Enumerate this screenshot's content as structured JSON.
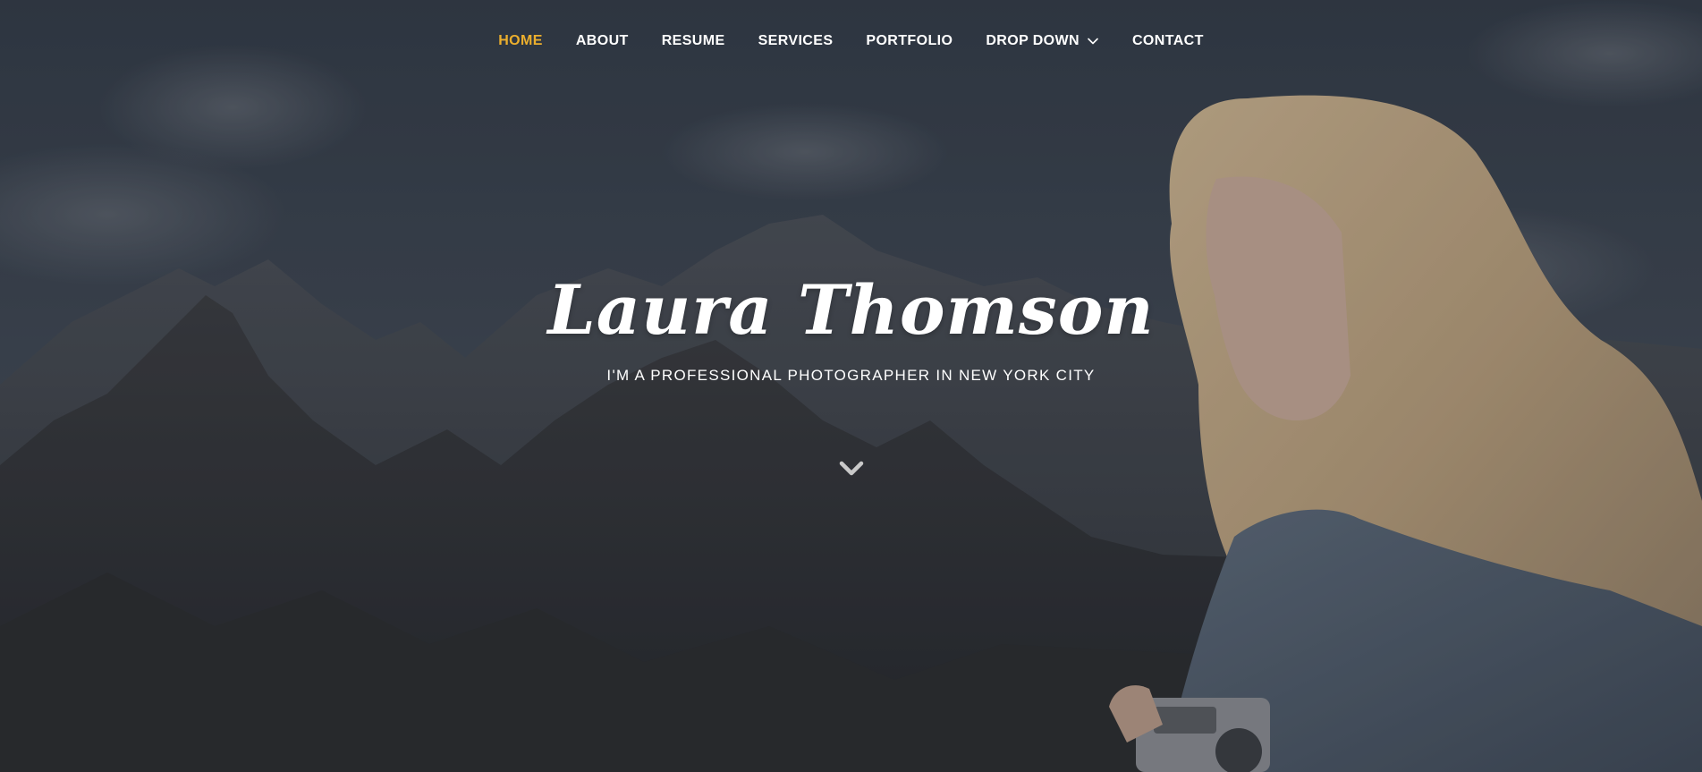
{
  "nav": {
    "items": [
      {
        "label": "HOME",
        "active": true
      },
      {
        "label": "ABOUT",
        "active": false
      },
      {
        "label": "RESUME",
        "active": false
      },
      {
        "label": "SERVICES",
        "active": false
      },
      {
        "label": "PORTFOLIO",
        "active": false
      },
      {
        "label": "DROP DOWN",
        "active": false,
        "has_dropdown": true
      },
      {
        "label": "CONTACT",
        "active": false
      }
    ]
  },
  "hero": {
    "name": "Laura Thomson",
    "tagline": "I'M A PROFESSIONAL PHOTOGRAPHER IN NEW YORK CITY"
  },
  "icons": {
    "dropdown": "chevron-down-icon",
    "scroll": "chevron-down-icon"
  },
  "colors": {
    "accent": "#ecaf2d",
    "text": "#ffffff",
    "overlay": "#1c222a"
  }
}
